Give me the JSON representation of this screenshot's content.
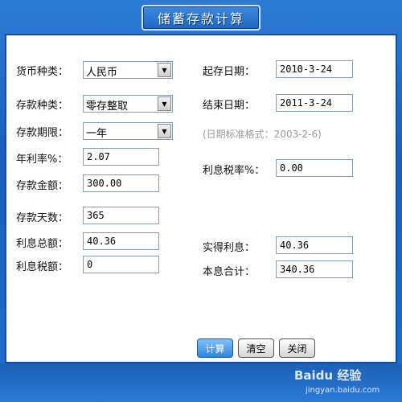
{
  "window": {
    "title": "储蓄存款计算"
  },
  "left": {
    "currency_label": "货币种类：",
    "currency_value": "人民币",
    "deposit_type_label": "存款种类：",
    "deposit_type_value": "零存整取",
    "term_label": "存款期限：",
    "term_value": "一年",
    "rate_label": "年利率%：",
    "rate_value": "2.07",
    "amount_label": "存款金额：",
    "amount_value": "300.00",
    "days_label": "存款天数：",
    "days_value": "365",
    "interest_total_label": "利息总额：",
    "interest_total_value": "40.36",
    "tax_amount_label": "利息税额：",
    "tax_amount_value": "0"
  },
  "right": {
    "start_label": "起存日期：",
    "start_value": "2010-3-24",
    "end_label": "结束日期：",
    "end_value": "2011-3-24",
    "date_hint": "(日期标准格式：2003-2-6)",
    "tax_rate_label": "利息税率%：",
    "tax_rate_value": "0.00",
    "net_interest_label": "实得利息：",
    "net_interest_value": "40.36",
    "principal_interest_label": "本息合计：",
    "principal_interest_value": "340.36"
  },
  "buttons": {
    "calculate": "计算",
    "clear": "清空",
    "close": "关闭"
  },
  "watermark": {
    "brand": "Baidu 经验",
    "url": "jingyan.baidu.com"
  },
  "icons": {
    "dropdown": "chevron-down-icon"
  }
}
